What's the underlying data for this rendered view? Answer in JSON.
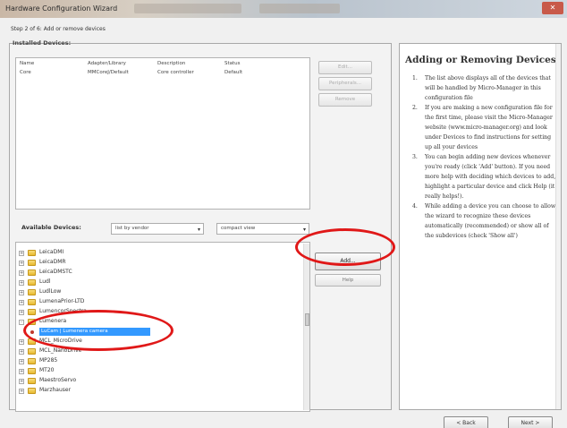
{
  "window": {
    "title": "Hardware Configuration Wizard",
    "close_label": "✕"
  },
  "step": "Step 2 of 6: Add or remove devices",
  "installed": {
    "group_label": "Installed Devices:",
    "columns": [
      "Name",
      "Adapter/Library",
      "Description",
      "Status"
    ],
    "rows": [
      [
        "Core",
        "MMCoreJ/Default",
        "Core controller",
        "Default"
      ]
    ],
    "buttons": [
      "Edit...",
      "Peripherals...",
      "Remove"
    ]
  },
  "available": {
    "label": "Available Devices:",
    "sort_dropdown": "list by vendor",
    "view_dropdown": "compact view",
    "tree_items": [
      "LeicaDMI",
      "LeicaDMR",
      "LeicaDMSTC",
      "Ludl",
      "LudlLow",
      "LumenaPrior-LTD",
      "LumencorSpectra",
      "Lumenera",
      "MCL_MicroDrive",
      "MCL_NanoDrive",
      "MP285",
      "MT20",
      "MaestroServo",
      "Marzhauser"
    ],
    "selected_child": "LuCam | Lumenera camera",
    "add_button": "Add...",
    "help_button": "Help"
  },
  "help": {
    "title": "Adding or Removing Devices",
    "items": [
      "The list above displays all of the devices that will be handled by Micro-Manager in this configuration file",
      "If you are making a new configuration file for the first time, please visit the Micro-Manager website (www.micro-manager.org) and look under Devices to find instructions for setting up all your devices",
      "You can begin adding new devices whenever you're ready (click 'Add' button). If you need more help with deciding which devices to add, highlight a particular device and click Help (it really helps!).",
      "While adding a device you can choose to allow the wizard to recognize these devices automatically (recommended) or show all of the subdevices (check 'Show all')"
    ]
  },
  "nav": {
    "back": "< Back",
    "next": "Next >"
  },
  "colors": {
    "annotation": "#e01818",
    "selection": "#3399ff"
  }
}
